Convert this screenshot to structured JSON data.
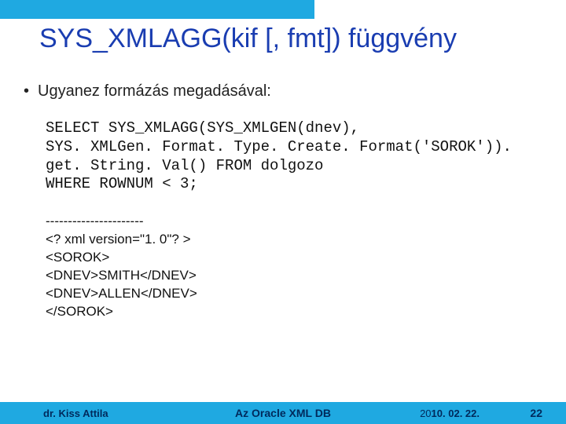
{
  "title": "SYS_XMLAGG(kif [, fmt]) függvény",
  "bullet1": "Ugyanez formázás megadásával:",
  "code": "SELECT SYS_XMLAGG(SYS_XMLGEN(dnev),\nSYS. XMLGen. Format. Type. Create. Format('SOROK')).\nget. String. Val() FROM dolgozo\nWHERE ROWNUM < 3;",
  "output": {
    "rule": "----------------------",
    "l1": " <? xml version=\"1. 0\"? >",
    "l2": " <SOROK>",
    "l3": "    <DNEV>SMITH</DNEV>",
    "l4": "    <DNEV>ALLEN</DNEV>",
    "l5": " </SOROK>"
  },
  "footer": {
    "author": "dr. Kiss Attila",
    "center": "Az Oracle XML DB",
    "date_light": "20",
    "date_bold": "10. 02. 22.",
    "page": "22"
  }
}
